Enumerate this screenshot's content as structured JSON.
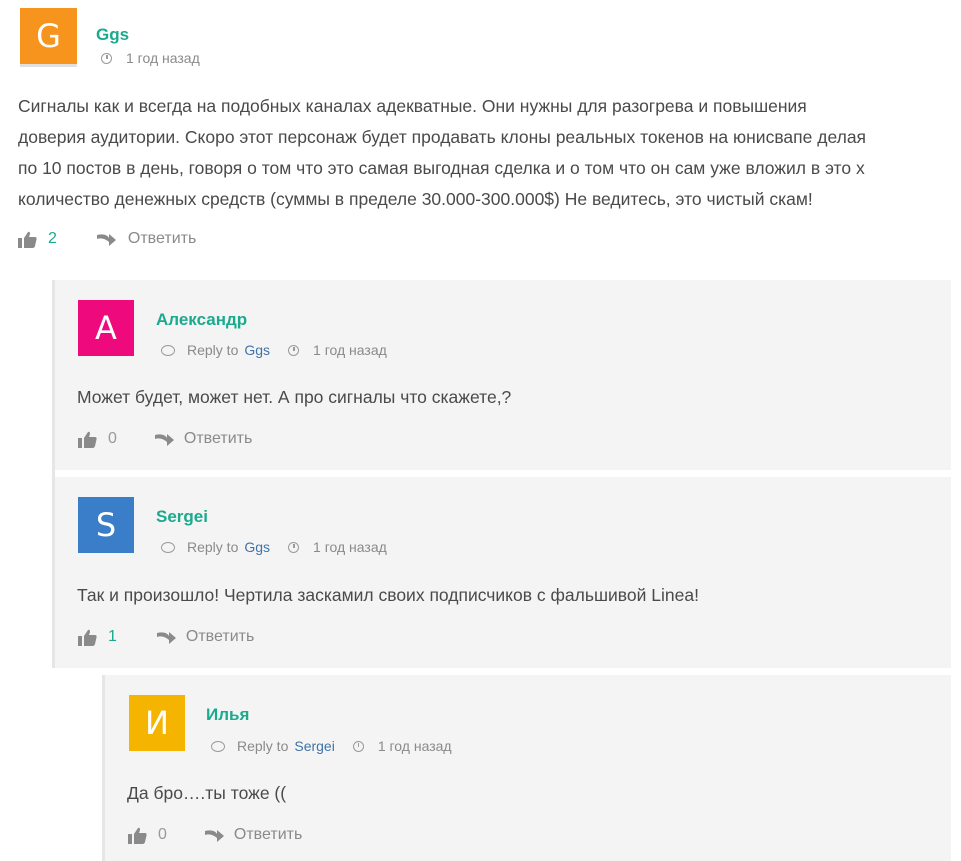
{
  "comments": [
    {
      "initial": "G",
      "avatar_color": "#f7941d",
      "author": "Ggs",
      "time": "1 год назад",
      "text_lines": [
        "Сигналы как и всегда на подобных каналах адекватные. Они нужны для разогрева и повышения",
        "доверия аудитории. Скоро этот персонаж будет продавать клоны реальных токенов на юнисвапе делая",
        "по 10 постов в день, говоря о том что это самая выгодная сделка и о том что он сам уже вложил в это х",
        "количество денежных средств (суммы в пределе 30.000-300.000$) Не ведитесь, это чистый скам!"
      ],
      "likes": "2",
      "reply_label": "Ответить"
    },
    {
      "initial": "А",
      "avatar_color": "#ee0a7d",
      "author": "Александр",
      "reply_to_label": "Reply to",
      "reply_to": "Ggs",
      "time": "1 год назад",
      "text": "Может будет, может нет. А про сигналы что скажете,?",
      "likes": "0",
      "reply_label": "Ответить"
    },
    {
      "initial": "S",
      "avatar_color": "#3a7dc9",
      "author": "Sergei",
      "reply_to_label": "Reply to",
      "reply_to": "Ggs",
      "time": "1 год назад",
      "text": "Так и произошло! Чертила заскамил своих подписчиков с фальшивой Linea!",
      "likes": "1",
      "reply_label": "Ответить"
    },
    {
      "initial": "И",
      "avatar_color": "#f4b400",
      "author": "Илья",
      "reply_to_label": "Reply to",
      "reply_to": "Sergei",
      "time": "1 год назад",
      "text": "Да бро….ты тоже ((",
      "likes": "0",
      "reply_label": "Ответить"
    }
  ],
  "icons": {
    "like": "thumbs-up-icon",
    "reply": "reply-arrow-icon",
    "clock": "clock-icon",
    "reply_to": "speech-bubble-icon"
  }
}
